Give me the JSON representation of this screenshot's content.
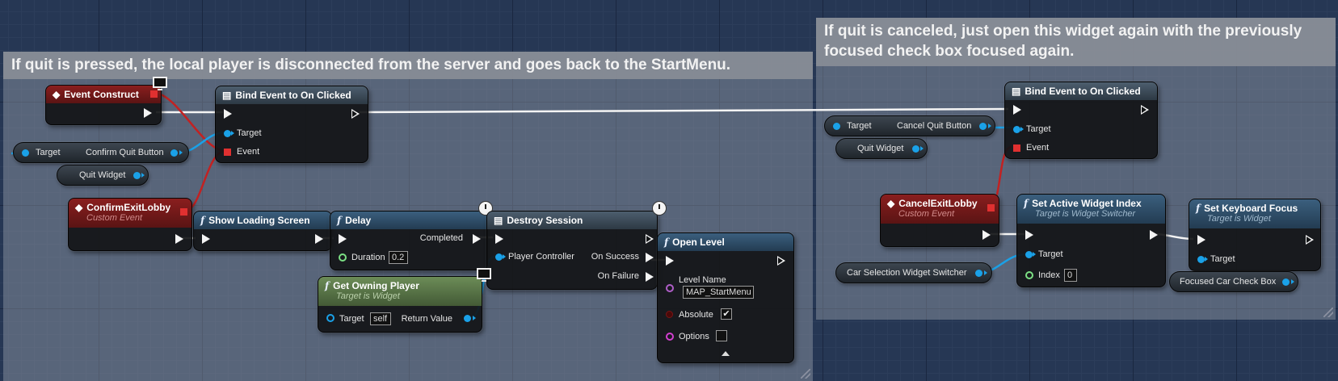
{
  "comments": {
    "left": "If quit is pressed, the local player is disconnected from the server and goes back to the StartMenu.",
    "right": "If quit is canceled, just open this widget again with the previously focused check box focused again."
  },
  "nodes": {
    "event_construct": {
      "title": "Event Construct"
    },
    "bind_left": {
      "title": "Bind Event to On Clicked",
      "target": "Target",
      "event": "Event"
    },
    "confirm_var": {
      "target": "Target",
      "label": "Confirm Quit Button"
    },
    "quit_widget_left": {
      "label": "Quit Widget"
    },
    "confirm_exit": {
      "title": "ConfirmExitLobby",
      "subtitle": "Custom Event"
    },
    "show_loading": {
      "title": "Show Loading Screen"
    },
    "delay": {
      "title": "Delay",
      "completed": "Completed",
      "duration": "Duration",
      "duration_value": "0.2"
    },
    "destroy": {
      "title": "Destroy Session",
      "player_controller": "Player Controller",
      "on_success": "On Success",
      "on_failure": "On Failure"
    },
    "get_owning": {
      "title": "Get Owning Player",
      "subtitle": "Target is Widget",
      "target": "Target",
      "target_value": "self",
      "return_value": "Return Value"
    },
    "open_level": {
      "title": "Open Level",
      "level_name": "Level Name",
      "level_value": "MAP_StartMenu",
      "absolute": "Absolute",
      "absolute_checked": "✔",
      "options": "Options"
    },
    "bind_right": {
      "title": "Bind Event to On Clicked",
      "target": "Target",
      "event": "Event"
    },
    "cancel_var": {
      "target": "Target",
      "label": "Cancel Quit Button"
    },
    "quit_widget_right": {
      "label": "Quit Widget"
    },
    "cancel_exit": {
      "title": "CancelExitLobby",
      "subtitle": "Custom Event"
    },
    "set_active": {
      "title": "Set Active Widget Index",
      "subtitle": "Target is Widget Switcher",
      "target": "Target",
      "index": "Index",
      "index_value": "0"
    },
    "set_focus": {
      "title": "Set Keyboard Focus",
      "subtitle": "Target is Widget",
      "target": "Target"
    },
    "car_switcher": {
      "label": "Car Selection Widget Switcher"
    },
    "focused_checkbox": {
      "label": "Focused Car Check Box"
    }
  }
}
